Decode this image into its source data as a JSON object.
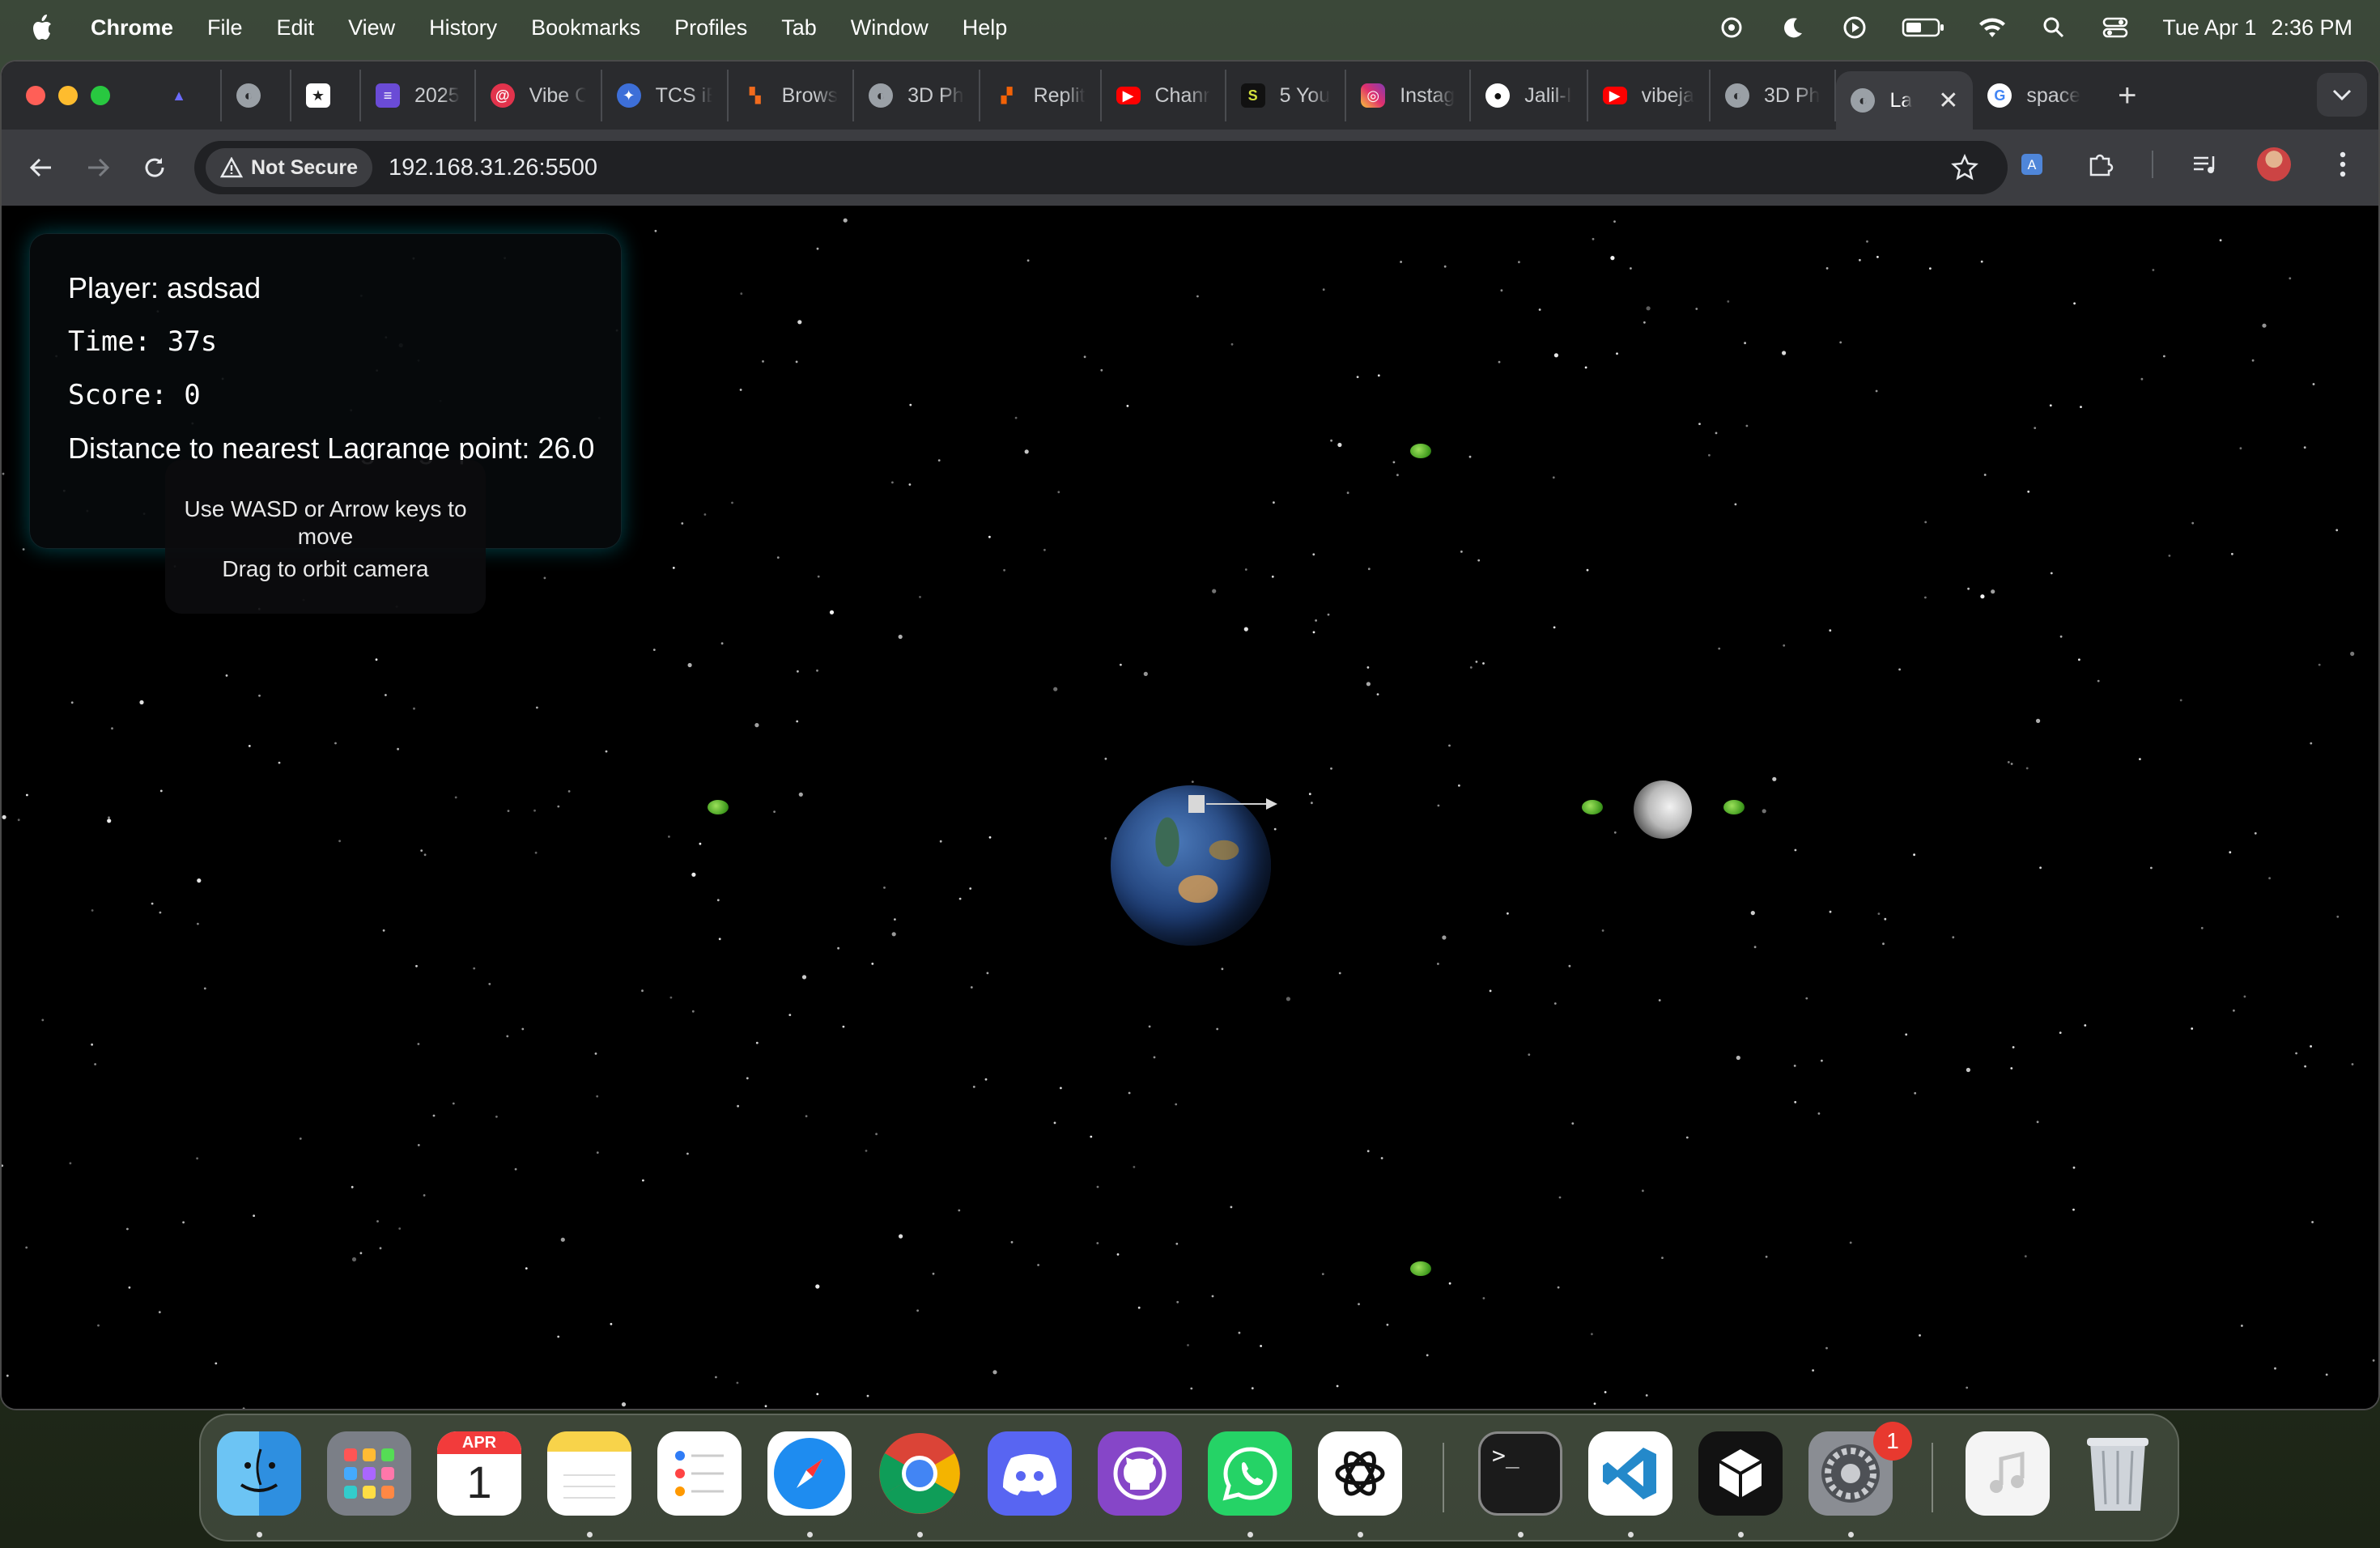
{
  "menubar": {
    "app": "Chrome",
    "items": [
      "File",
      "Edit",
      "View",
      "History",
      "Bookmarks",
      "Profiles",
      "Tab",
      "Window",
      "Help"
    ],
    "date": "Tue Apr 1",
    "time": "2:36 PM"
  },
  "tabs": [
    {
      "label": "",
      "icon": "rocket-icon"
    },
    {
      "label": "",
      "icon": "globe-icon"
    },
    {
      "label": "",
      "icon": "star-app-icon"
    },
    {
      "label": "2025",
      "icon": "list-icon"
    },
    {
      "label": "Vibe C",
      "icon": "spiral-icon"
    },
    {
      "label": "TCS iE",
      "icon": "badge-icon"
    },
    {
      "label": "Brows",
      "icon": "figma-like-icon"
    },
    {
      "label": "3D Ph",
      "icon": "globe-icon"
    },
    {
      "label": "Replit",
      "icon": "replit-icon"
    },
    {
      "label": "Chanr",
      "icon": "youtube-icon"
    },
    {
      "label": "5 You",
      "icon": "app-icon"
    },
    {
      "label": "Instag",
      "icon": "instagram-icon"
    },
    {
      "label": "Jalil-I",
      "icon": "github-icon"
    },
    {
      "label": "vibeja",
      "icon": "youtube-icon"
    },
    {
      "label": "3D Ph",
      "icon": "globe-icon"
    },
    {
      "label": "La",
      "icon": "globe-icon",
      "active": true
    },
    {
      "label": "space",
      "icon": "google-icon"
    }
  ],
  "toolbar": {
    "security_chip": "Not Secure",
    "url": "192.168.31.26:5500"
  },
  "hud": {
    "player": "Player: asdsad",
    "time": "Time: 37s",
    "score": "Score: 0",
    "distance_prefix": "Distanc",
    "distance_hidden": "e to nearest Lagrange po",
    "distance_suffix": "int: 26.0"
  },
  "hint": {
    "line1": "Use WASD or Arrow keys to move",
    "line2": "Drag to orbit camera"
  },
  "dock": {
    "apps": [
      "Finder",
      "Launchpad",
      "Calendar",
      "Notes",
      "Reminders",
      "Safari",
      "Chrome",
      "Discord",
      "GitHub Desktop",
      "WhatsApp",
      "ChatGPT",
      "Terminal",
      "VS Code",
      "Unity Hub",
      "System Settings",
      "Music",
      "Trash"
    ],
    "calendar_month": "APR",
    "calendar_day": "1",
    "settings_badge": "1"
  },
  "colors": {
    "hud_glow": "#00c8dc",
    "lagrange_point": "#5fbf2a",
    "page_bg": "#000000",
    "active_tab": "#3c3d41"
  }
}
